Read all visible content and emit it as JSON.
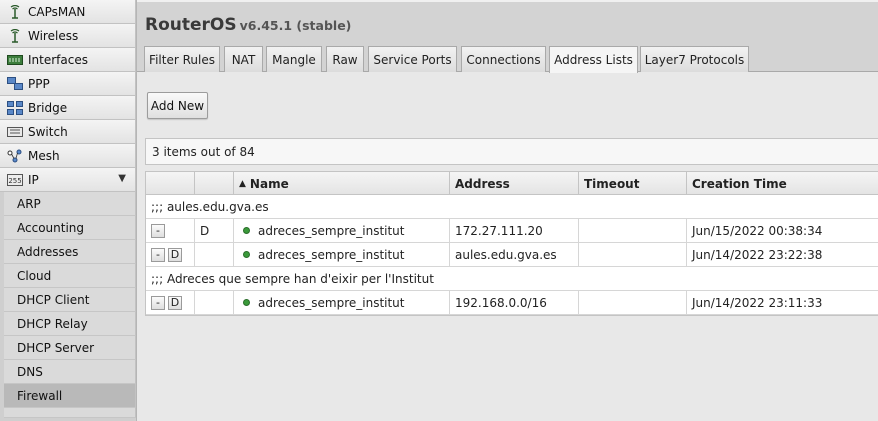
{
  "sidebar": {
    "items": [
      {
        "label": "CAPsMAN",
        "icon": "antenna-icon"
      },
      {
        "label": "Wireless",
        "icon": "antenna-icon"
      },
      {
        "label": "Interfaces",
        "icon": "interfaces-icon"
      },
      {
        "label": "PPP",
        "icon": "ppp-icon"
      },
      {
        "label": "Bridge",
        "icon": "bridge-icon"
      },
      {
        "label": "Switch",
        "icon": "switch-icon"
      },
      {
        "label": "Mesh",
        "icon": "mesh-icon"
      },
      {
        "label": "IP",
        "icon": "ip-icon",
        "expand": "▼"
      }
    ],
    "ip_submenu": [
      "ARP",
      "Accounting",
      "Addresses",
      "Cloud",
      "DHCP Client",
      "DHCP Relay",
      "DHCP Server",
      "DNS",
      "Firewall"
    ],
    "active_submenu": "Firewall"
  },
  "header": {
    "title": "RouterOS",
    "version": "v6.45.1 (stable)"
  },
  "tabs": [
    "Filter Rules",
    "NAT",
    "Mangle",
    "Raw",
    "Service Ports",
    "Connections",
    "Address Lists",
    "Layer7 Protocols"
  ],
  "active_tab": "Address Lists",
  "toolbar": {
    "add_new_label": "Add New"
  },
  "count_text": "3 items out of 84",
  "table": {
    "headers": {
      "sort_arrow": "▲",
      "name": "Name",
      "address": "Address",
      "timeout": "Timeout",
      "creation_time": "Creation Time"
    },
    "comment_1": ";;; aules.edu.gva.es",
    "comment_2": ";;; Adreces que sempre han d'eixir per l'Institut",
    "rows": [
      {
        "remove": "-",
        "disable": "",
        "flag": "D",
        "name": "adreces_sempre_institut",
        "address": "172.27.111.20",
        "timeout": "",
        "creation_time": "Jun/15/2022 00:38:34"
      },
      {
        "remove": "-",
        "disable": "D",
        "flag": "",
        "name": "adreces_sempre_institut",
        "address": "aules.edu.gva.es",
        "timeout": "",
        "creation_time": "Jun/14/2022 23:22:38"
      },
      {
        "remove": "-",
        "disable": "D",
        "flag": "",
        "name": "adreces_sempre_institut",
        "address": "192.168.0.0/16",
        "timeout": "",
        "creation_time": "Jun/14/2022 23:11:33"
      }
    ]
  },
  "colors": {
    "enabled_dot": "#3a9a3a",
    "active_submenu_bg": "#b9b9b9"
  }
}
